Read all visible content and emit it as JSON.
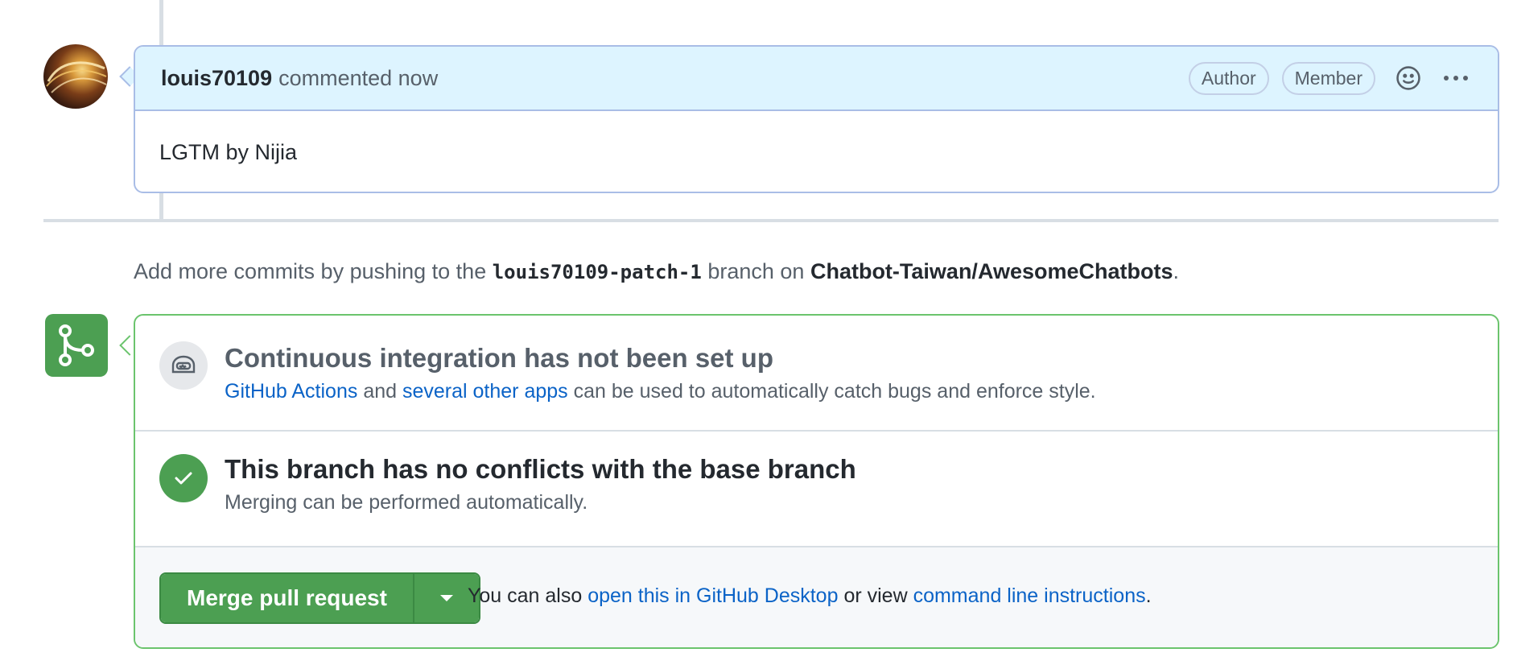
{
  "comment": {
    "author": "louis70109",
    "action": "commented now",
    "badges": [
      "Author",
      "Member"
    ],
    "body": "LGTM by Nijia",
    "icons": {
      "reaction": "smiley-icon",
      "menu": "kebab-horizontal-icon"
    }
  },
  "push_hint": {
    "prefix": "Add more commits by pushing to the",
    "branch": "louis70109-patch-1",
    "middle": "branch on",
    "repo": "Chatbot-Taiwan/AwesomeChatbots",
    "suffix": "."
  },
  "merge_box": {
    "icon": "git-merge-icon",
    "ci": {
      "icon": "robot-icon",
      "title": "Continuous integration has not been set up",
      "link1": "GitHub Actions",
      "and": "and",
      "link2": "several other apps",
      "rest": "can be used to automatically catch bugs and enforce style."
    },
    "conflicts": {
      "icon": "check-icon",
      "title": "This branch has no conflicts with the base branch",
      "desc": "Merging can be performed automatically."
    },
    "actions": {
      "merge_label": "Merge pull request",
      "dropdown_icon": "triangle-down-icon",
      "text_prefix": "You can also",
      "link_desktop": "open this in GitHub Desktop",
      "text_middle": "or view",
      "link_cli": "command line instructions",
      "text_suffix": "."
    }
  },
  "colors": {
    "accent_blue": "#0b63c7",
    "success_green": "#4c9f52",
    "comment_header_bg": "#ddf4ff",
    "muted_text": "#57606a"
  }
}
